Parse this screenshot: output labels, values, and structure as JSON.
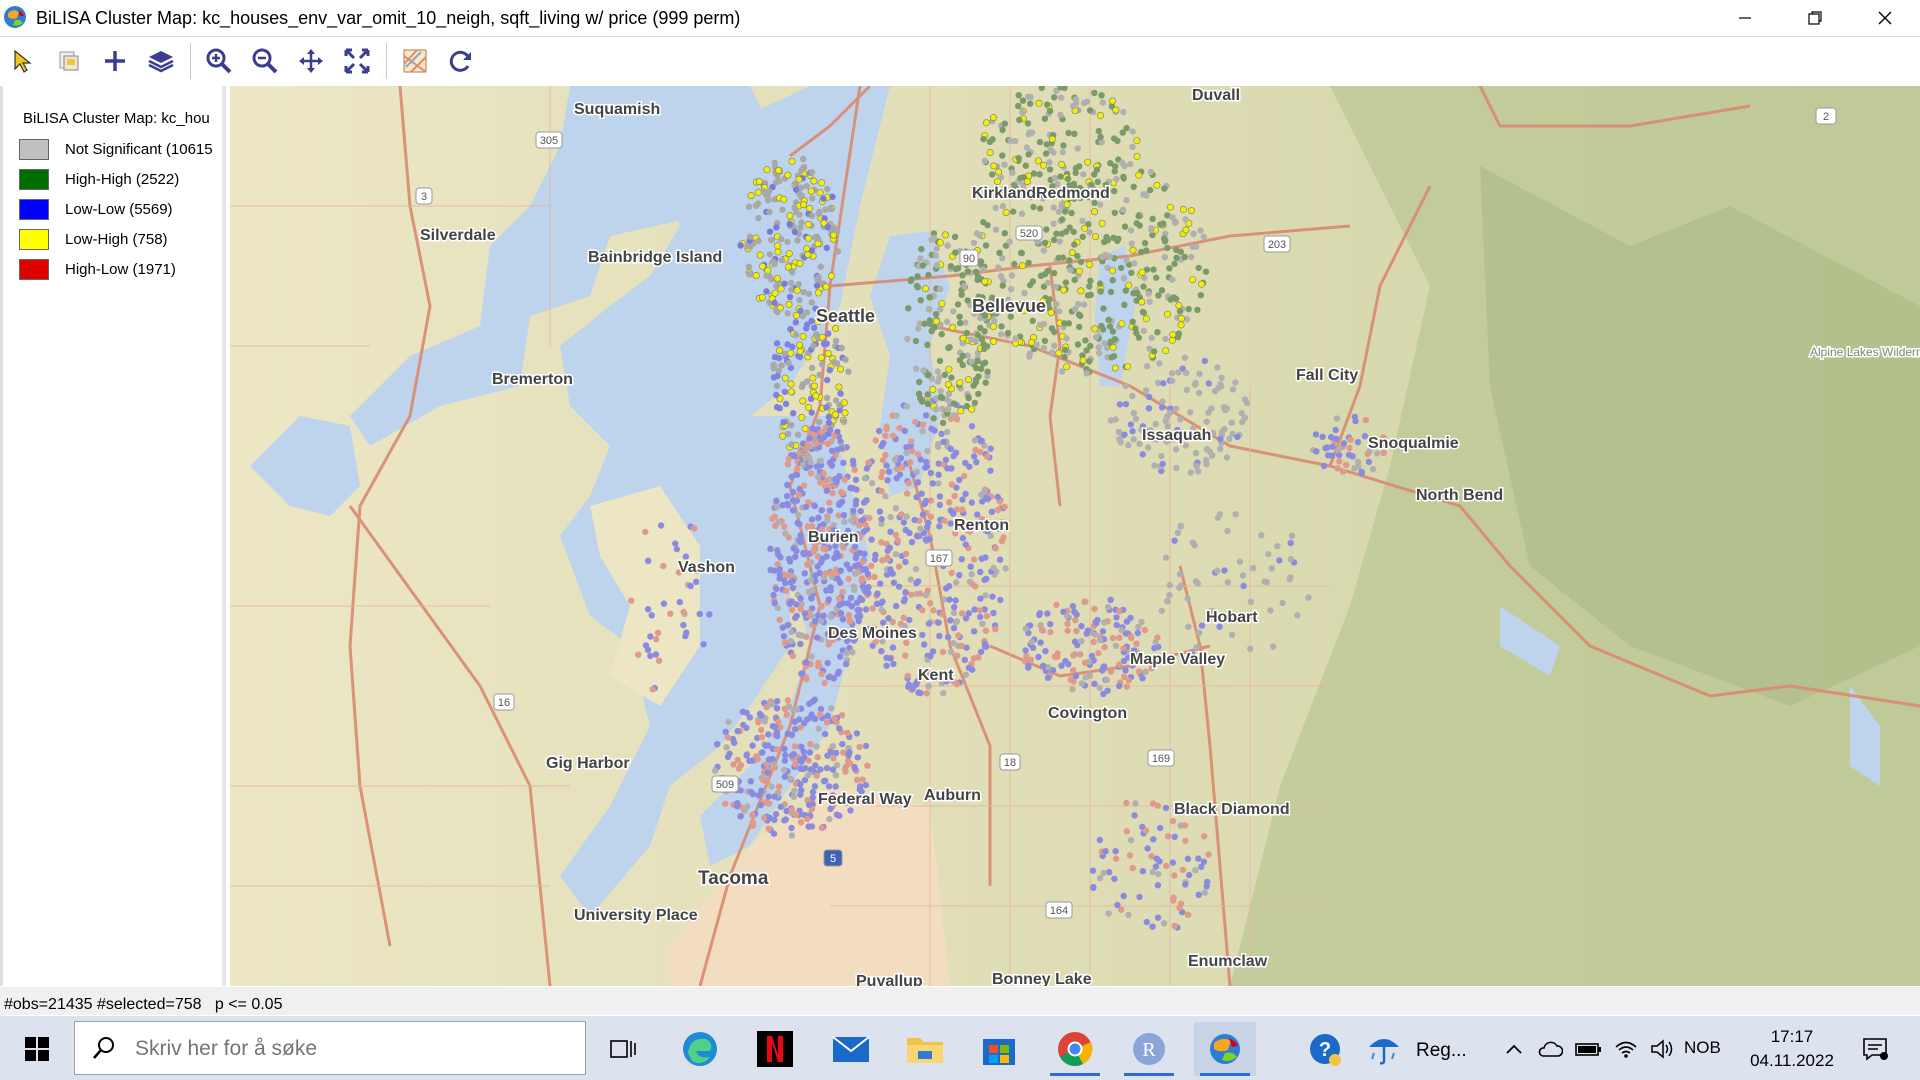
{
  "window": {
    "title": "BiLISA Cluster Map: kc_houses_env_var_omit_10_neigh, sqft_living w/ price (999 perm)"
  },
  "toolbar": {
    "tools": [
      "select-arrow-icon",
      "copy-image-icon",
      "add-layer-plus-icon",
      "layers-icon",
      "zoom-in-icon",
      "zoom-out-icon",
      "pan-icon",
      "extent-icon",
      "basemap-icon",
      "refresh-icon"
    ]
  },
  "legend": {
    "title": "BiLISA Cluster Map: kc_hou",
    "items": [
      {
        "label": "Not Significant (10615",
        "color": "#c0c0c0"
      },
      {
        "label": "High-High (2522)",
        "color": "#006d00"
      },
      {
        "label": "Low-Low (5569)",
        "color": "#0000ff"
      },
      {
        "label": "Low-High (758)",
        "color": "#ffff00"
      },
      {
        "label": "High-Low (1971)",
        "color": "#e00000"
      }
    ]
  },
  "map": {
    "places": [
      "Suquamish",
      "Duvall",
      "Kirkland",
      "Redmond",
      "Silverdale",
      "Bainbridge Island",
      "Seattle",
      "Bellevue",
      "Bremerton",
      "Fall City",
      "Issaquah",
      "Snoqualmie",
      "North Bend",
      "Alpine Lakes Wilderness",
      "Burien",
      "Renton",
      "Vashon",
      "Hobart",
      "Des Moines",
      "Kent",
      "Maple Valley",
      "Covington",
      "Gig Harbor",
      "Federal Way",
      "Auburn",
      "Black Diamond",
      "Tacoma",
      "University Place",
      "Enumclaw",
      "Puyallup",
      "Bonney Lake"
    ],
    "shields": [
      "305",
      "3",
      "520",
      "90",
      "167",
      "16",
      "509",
      "5",
      "18",
      "169",
      "164",
      "2",
      "203"
    ]
  },
  "status": {
    "text": "#obs=21435 #selected=758   p <= 0.05"
  },
  "taskbar": {
    "search_placeholder": "Skriv her for å søke",
    "weather_label": "Reg...",
    "language": "NOB",
    "time": "17:17",
    "date": "04.11.2022"
  }
}
